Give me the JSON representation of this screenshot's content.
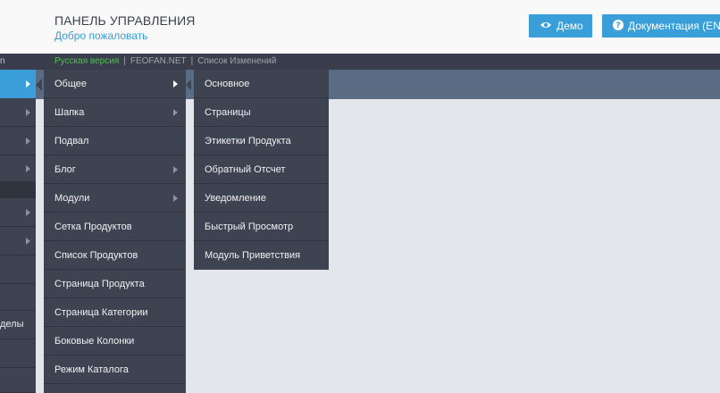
{
  "header": {
    "title": "ПАНЕЛЬ УПРАВЛЕНИЯ",
    "subtitle": "Добро пожаловать",
    "demo_label": "Демо",
    "docs_label": "Документация (EN)",
    "accent_color": "#3a9ed9"
  },
  "topbar": {
    "left_fragment": "n",
    "links": [
      {
        "label": "Русская версия",
        "active": true
      },
      {
        "label": "FEOFAN.NET",
        "active": false
      },
      {
        "label": "Список Изменений",
        "active": false
      }
    ],
    "active_color": "#4ec24e"
  },
  "sidebar": {
    "partial_label": "делы"
  },
  "submenu": {
    "items": [
      {
        "label": "Общее",
        "has_children": true
      },
      {
        "label": "Шапка",
        "has_children": true
      },
      {
        "label": "Подвал",
        "has_children": false
      },
      {
        "label": "Блог",
        "has_children": true
      },
      {
        "label": "Модули",
        "has_children": true
      },
      {
        "label": "Сетка Продуктов",
        "has_children": false
      },
      {
        "label": "Список Продуктов",
        "has_children": false
      },
      {
        "label": "Страница Продукта",
        "has_children": false
      },
      {
        "label": "Страница Категории",
        "has_children": false
      },
      {
        "label": "Боковые Колонки",
        "has_children": false
      },
      {
        "label": "Режим Каталога",
        "has_children": false
      }
    ]
  },
  "subsubmenu": {
    "items": [
      {
        "label": "Основное"
      },
      {
        "label": "Страницы"
      },
      {
        "label": "Этикетки Продукта"
      },
      {
        "label": "Обратный Отсчет"
      },
      {
        "label": "Уведомление"
      },
      {
        "label": "Быстрый Просмотр"
      },
      {
        "label": "Модуль Приветствия"
      }
    ]
  }
}
